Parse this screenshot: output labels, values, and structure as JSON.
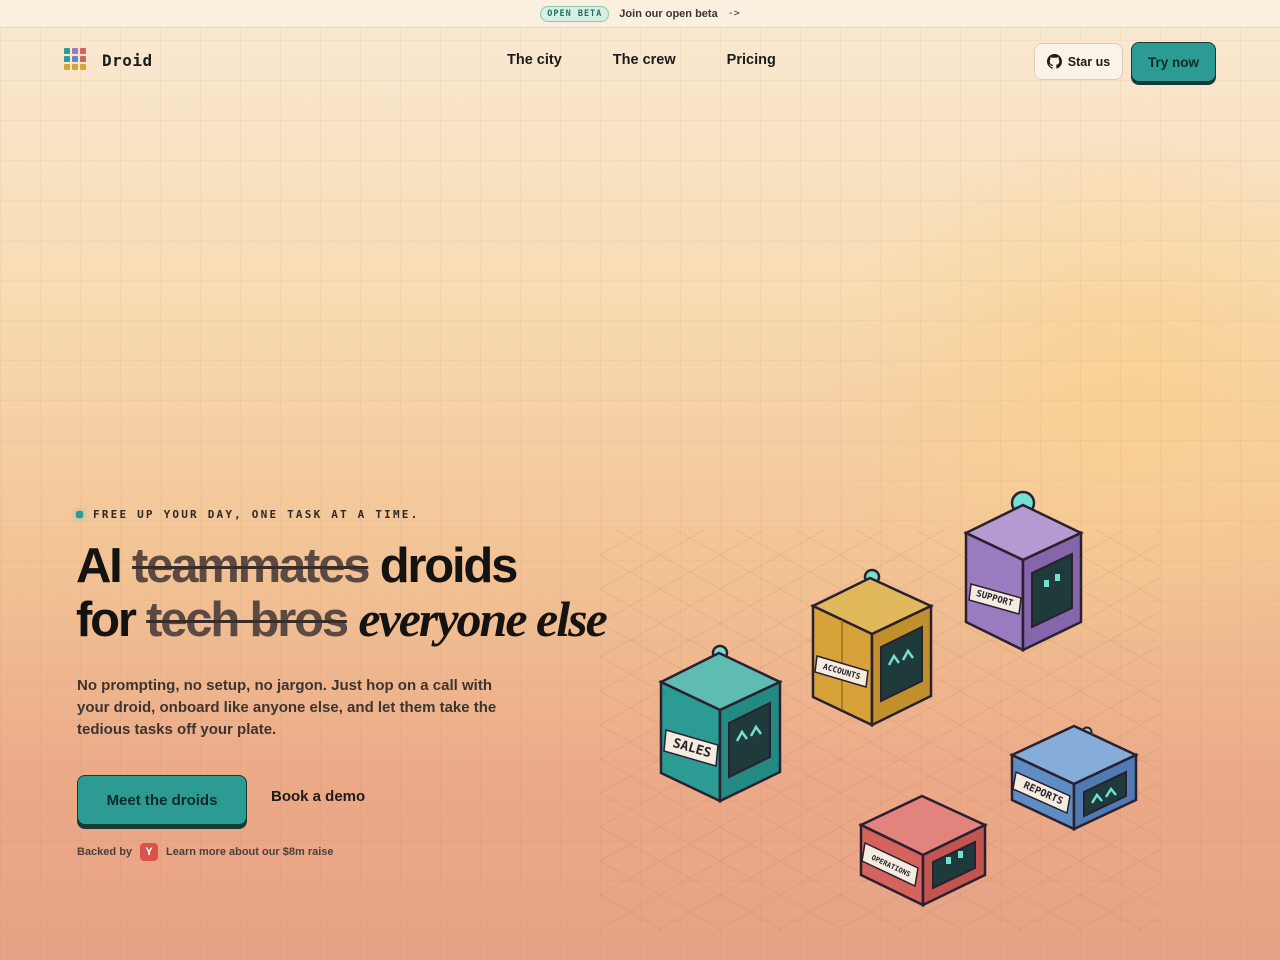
{
  "announcement": {
    "badge": "OPEN BETA",
    "text": "Join our open beta",
    "arrow": "->"
  },
  "nav": {
    "brand": "Droid",
    "links": [
      "The city",
      "The crew",
      "Pricing"
    ],
    "star_label": "Star us",
    "try_label": "Try now"
  },
  "hero": {
    "eyebrow": "FREE UP YOUR DAY, ONE TASK AT A TIME.",
    "line1": {
      "prefix": "AI",
      "struck": "teammates",
      "suffix": "droids"
    },
    "line2": {
      "prefix": "for",
      "struck": "tech bros",
      "suffix": "everyone else"
    },
    "subcopy": "No prompting, no setup, no jargon. Just hop on a call with your droid, onboard like anyone else, and let them take the tedious tasks off your plate.",
    "primary_cta": "Meet the droids",
    "secondary_cta": "Book a demo",
    "backed_by": "Backed by",
    "backer_badge": "Y",
    "raise_link": "Learn more about our $8m raise"
  },
  "droids": [
    {
      "label": "SALES",
      "color": "#2b9b93"
    },
    {
      "label": "ACCOUNTS",
      "color": "#d7a23a"
    },
    {
      "label": "SUPPORT",
      "color": "#9b7bc0"
    },
    {
      "label": "REPORTS",
      "color": "#5e8cc4"
    },
    {
      "label": "OPERATIONS",
      "color": "#d4625d"
    }
  ],
  "colors": {
    "accent": "#2b9b93",
    "ink": "#163b36",
    "yc": "#d8544a"
  }
}
